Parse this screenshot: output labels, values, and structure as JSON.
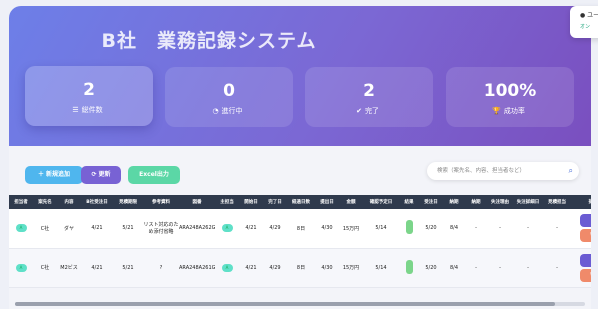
{
  "header": {
    "title": "B社　業務記録システム",
    "stats": [
      {
        "value": "2",
        "label": "総件数",
        "icon": "list-icon"
      },
      {
        "value": "0",
        "label": "進行中",
        "icon": "clock-icon"
      },
      {
        "value": "2",
        "label": "完了",
        "icon": "check-icon"
      },
      {
        "value": "100%",
        "label": "成功率",
        "icon": "trophy-icon"
      }
    ]
  },
  "user": {
    "label": "ユー",
    "status": "オン"
  },
  "toolbar": {
    "new_label": "＋ 新規追加",
    "refresh_label": "⟳ 更新",
    "excel_label": "Excel出力"
  },
  "search": {
    "placeholder": "検索（案先名、内容、担当者など）"
  },
  "table": {
    "columns": [
      "担当者",
      "案先名",
      "内容",
      "B社受注日",
      "見積期限",
      "参考資料",
      "図番",
      "主担当",
      "開始日",
      "完了日",
      "経過日数",
      "提出日",
      "金額",
      "確認予定日",
      "結果",
      "受注日",
      "納期",
      "納期",
      "失注理由",
      "失注詳細日",
      "見積担当",
      "操作"
    ],
    "rows": [
      [
        "A",
        "C社",
        "ダヤ",
        "4/21",
        "5/21",
        "リスト対応のため添付省略",
        "ARA248A262G",
        "A",
        "4/21",
        "4/29",
        "8日",
        "4/30",
        "15万円",
        "5/14",
        "",
        "5/20",
        "8/4",
        "-",
        "-",
        "-",
        "-",
        ""
      ],
      [
        "A",
        "C社",
        "M2ビス",
        "4/21",
        "5/21",
        "?",
        "ARA248A261G",
        "A",
        "4/21",
        "4/29",
        "8日",
        "4/30",
        "15万円",
        "5/14",
        "",
        "5/20",
        "8/4",
        "-",
        "-",
        "-",
        "-",
        ""
      ]
    ]
  },
  "colors": {
    "accent": "#7b68d4",
    "header_bg": "#2f3a4d"
  }
}
